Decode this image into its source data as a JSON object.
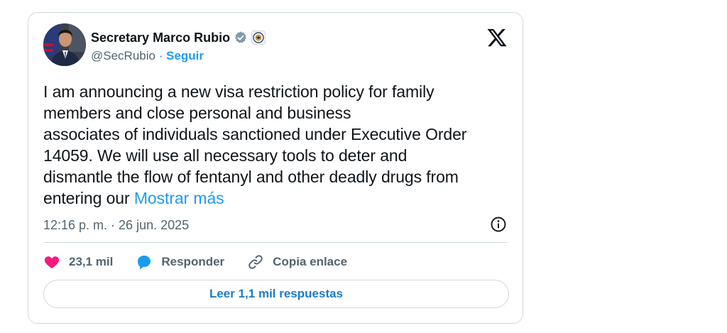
{
  "author": {
    "name": "Secretary Marco Rubio",
    "handle": "@SecRubio",
    "separator": "·",
    "follow_label": "Seguir"
  },
  "icons": {
    "verified": "verified-badge-icon",
    "affiliate": "state-department-seal-icon",
    "platform": "x-logo-icon",
    "info": "info-icon",
    "like": "heart-icon",
    "reply": "speech-bubble-icon",
    "copy": "link-icon"
  },
  "tweet": {
    "text": "I am announcing a new visa restriction policy for family\nmembers and close personal and business\nassociates of individuals sanctioned under Executive Order\n14059. We will use all necessary tools to deter and\ndismantle the flow of fentanyl and other deadly drugs from\nentering our ",
    "show_more_label": "Mostrar más",
    "timestamp": "12:16 p. m. · 26 jun. 2025"
  },
  "actions": {
    "likes_count": "23,1 mil",
    "reply_label": "Responder",
    "copy_link_label": "Copia enlace",
    "read_replies_label": "Leer 1,1 mil respuestas"
  },
  "colors": {
    "accent": "#1d9bf0",
    "like": "#f91880",
    "text": "#0f1419",
    "muted": "#536471",
    "border": "#cfd9de"
  }
}
